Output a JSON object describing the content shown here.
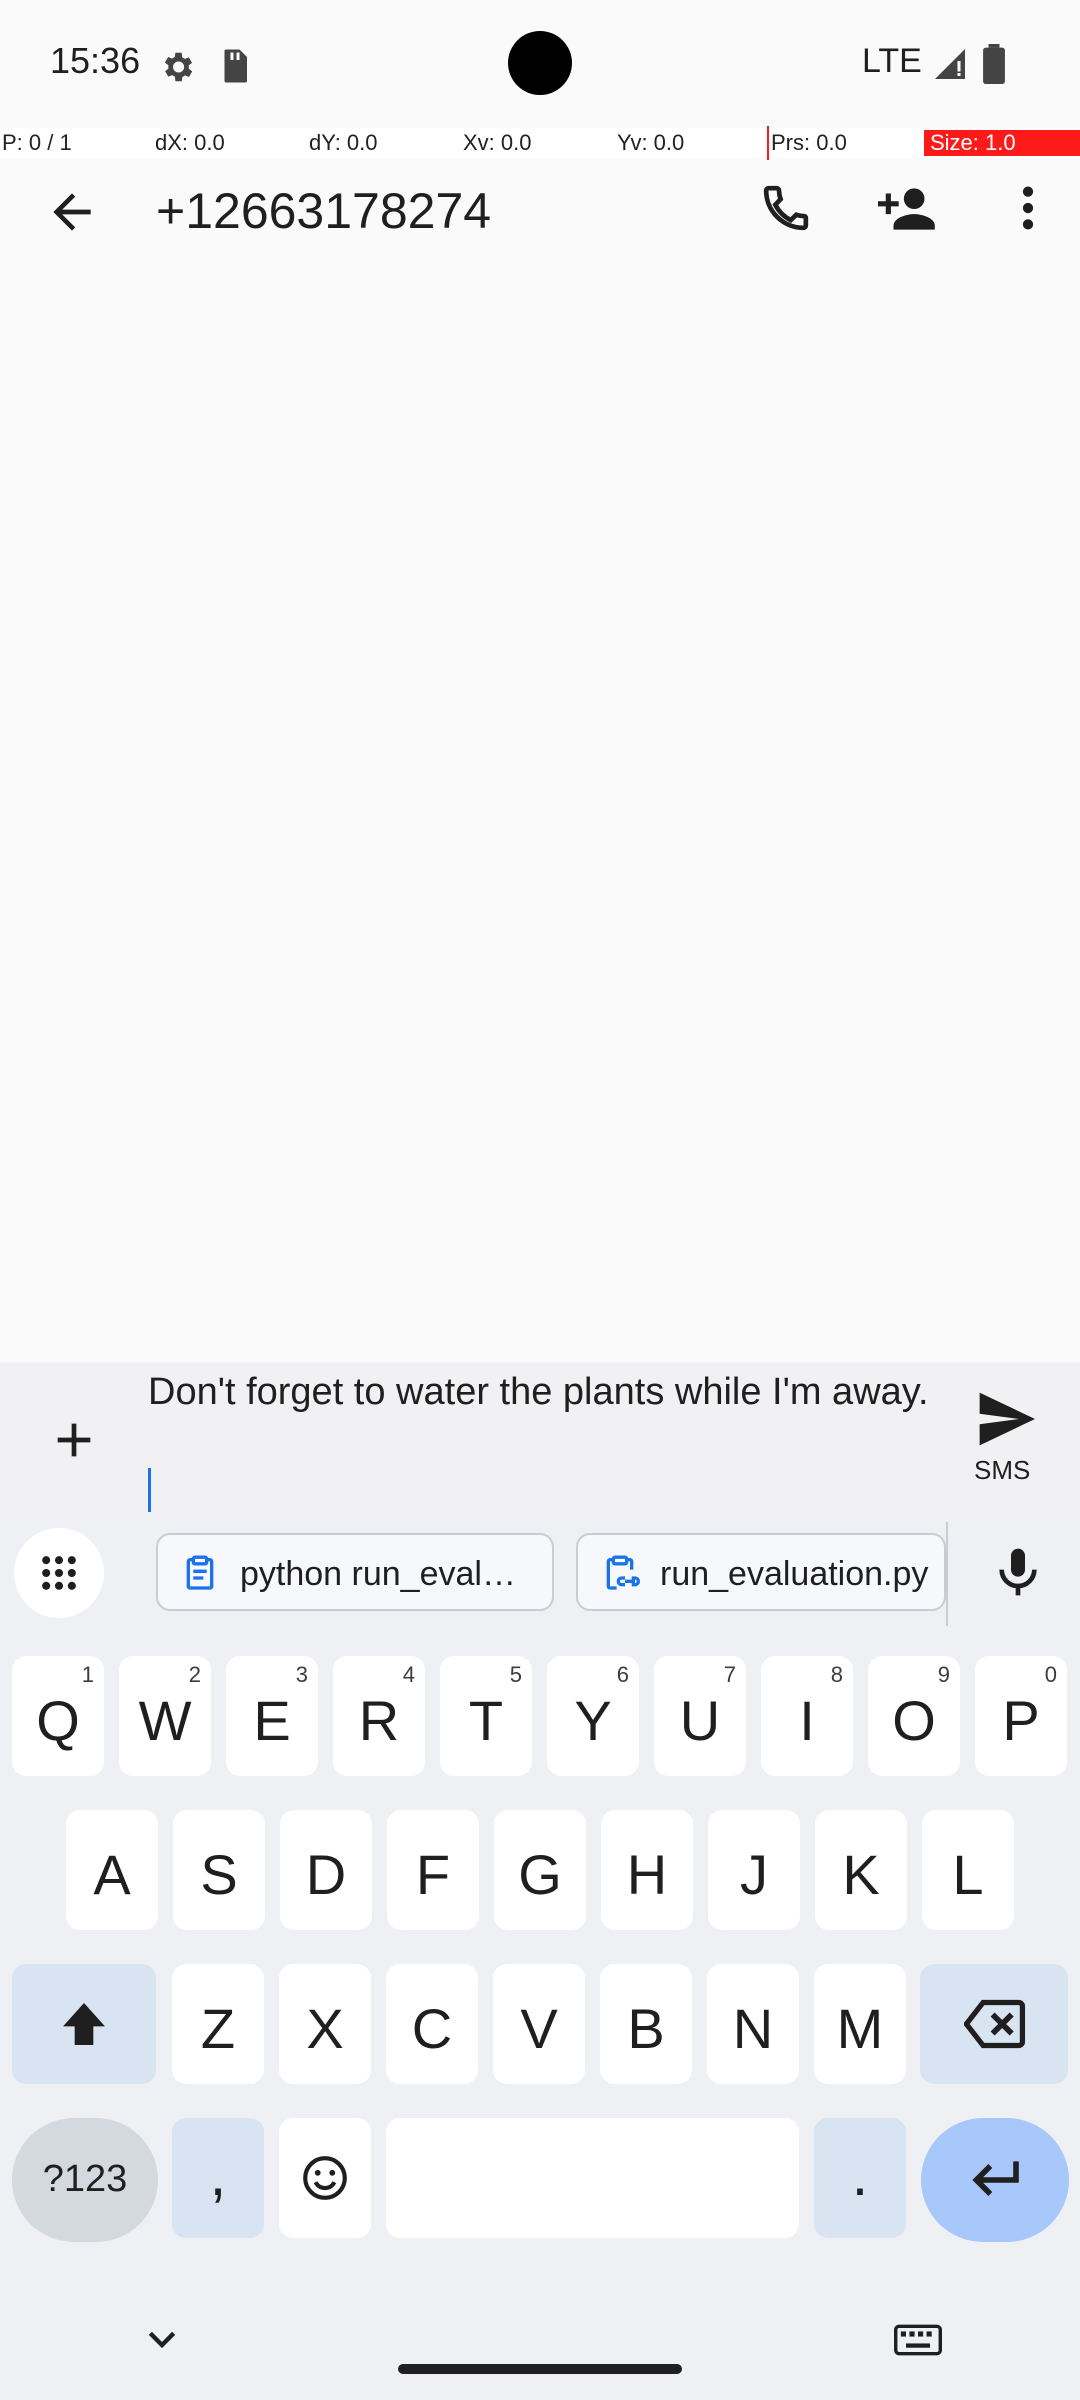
{
  "status_bar": {
    "time": "15:36",
    "network": "LTE"
  },
  "debug_overlay": {
    "p": "P: 0 / 1",
    "dx": "dX: 0.0",
    "dy": "dY: 0.0",
    "xv": "Xv: 0.0",
    "yv": "Yv: 0.0",
    "prs": "Prs: 0.0",
    "size": "Size: 1.0"
  },
  "app_bar": {
    "title": "+12663178274"
  },
  "compose": {
    "message": "Don't forget to water the plants while I'm away.",
    "send_label": "SMS"
  },
  "keyboard": {
    "clipboard_chips": [
      {
        "text": "python run_evaluation.py",
        "icon": "clipboard-icon"
      },
      {
        "text": "run_evaluation.py",
        "icon": "clipboard-link-icon"
      }
    ],
    "row1": [
      {
        "letter": "Q",
        "hint": "1"
      },
      {
        "letter": "W",
        "hint": "2"
      },
      {
        "letter": "E",
        "hint": "3"
      },
      {
        "letter": "R",
        "hint": "4"
      },
      {
        "letter": "T",
        "hint": "5"
      },
      {
        "letter": "Y",
        "hint": "6"
      },
      {
        "letter": "U",
        "hint": "7"
      },
      {
        "letter": "I",
        "hint": "8"
      },
      {
        "letter": "O",
        "hint": "9"
      },
      {
        "letter": "P",
        "hint": "0"
      }
    ],
    "row2": [
      "A",
      "S",
      "D",
      "F",
      "G",
      "H",
      "J",
      "K",
      "L"
    ],
    "row3": [
      "Z",
      "X",
      "C",
      "V",
      "B",
      "N",
      "M"
    ],
    "symbols_label": "?123",
    "comma": ",",
    "period": ".",
    "accent_color": "#1a73e8"
  }
}
